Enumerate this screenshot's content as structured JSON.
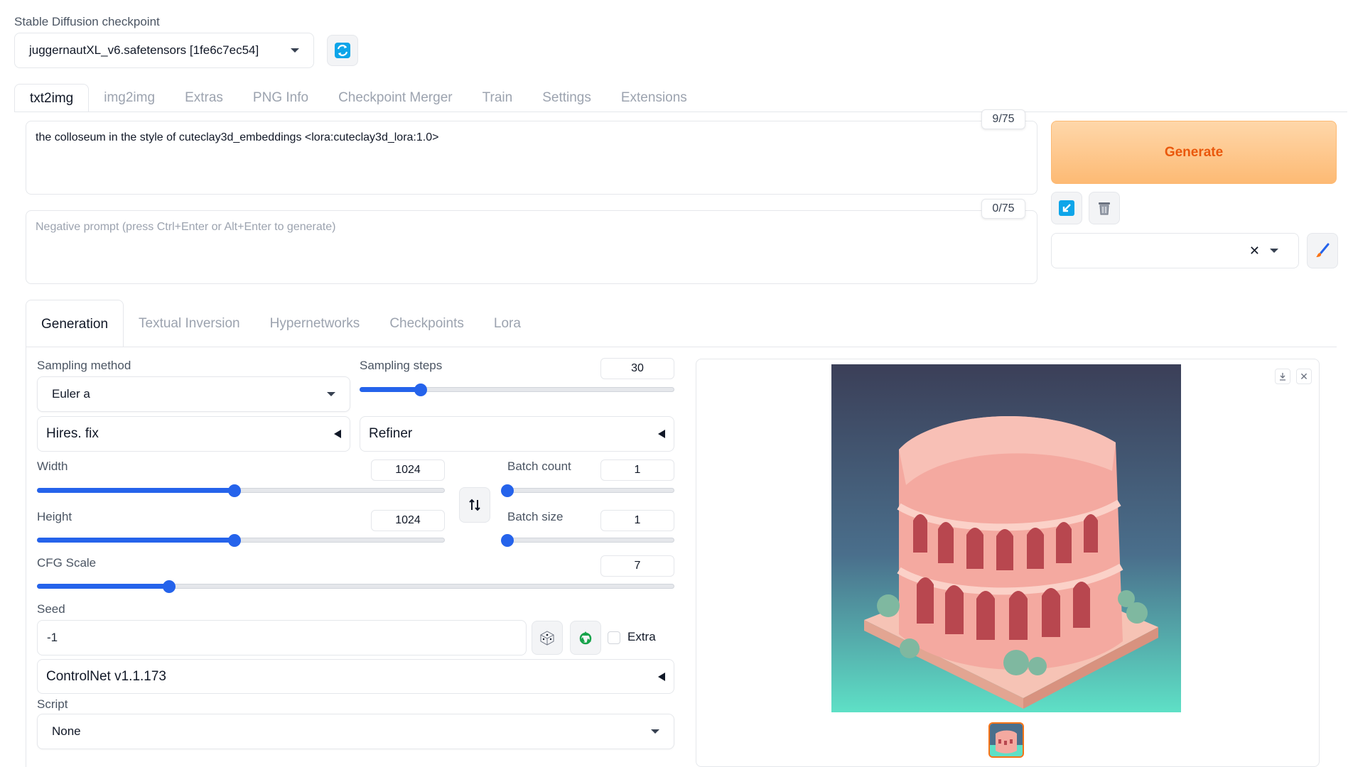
{
  "checkpoint": {
    "label": "Stable Diffusion checkpoint",
    "value": "juggernautXL_v6.safetensors [1fe6c7ec54]"
  },
  "top_tabs": [
    "txt2img",
    "img2img",
    "Extras",
    "PNG Info",
    "Checkpoint Merger",
    "Train",
    "Settings",
    "Extensions"
  ],
  "prompt": {
    "value": "the colloseum in the style of cuteclay3d_embeddings <lora:cuteclay3d_lora:1.0>",
    "counter": "9/75"
  },
  "negative_prompt": {
    "placeholder": "Negative prompt (press Ctrl+Enter or Alt+Enter to generate)",
    "counter": "0/75"
  },
  "generate_label": "Generate",
  "sub_tabs": [
    "Generation",
    "Textual Inversion",
    "Hypernetworks",
    "Checkpoints",
    "Lora"
  ],
  "sampling_method": {
    "label": "Sampling method",
    "value": "Euler a"
  },
  "sampling_steps": {
    "label": "Sampling steps",
    "value": "30",
    "min": 1,
    "max": 150
  },
  "hires_fix": "Hires. fix",
  "refiner": "Refiner",
  "width": {
    "label": "Width",
    "value": "1024",
    "min": 64,
    "max": 2048
  },
  "height": {
    "label": "Height",
    "value": "1024",
    "min": 64,
    "max": 2048
  },
  "batch_count": {
    "label": "Batch count",
    "value": "1",
    "min": 1,
    "max": 100
  },
  "batch_size": {
    "label": "Batch size",
    "value": "1",
    "min": 1,
    "max": 8
  },
  "cfg_scale": {
    "label": "CFG Scale",
    "value": "7",
    "min": 1,
    "max": 30
  },
  "seed": {
    "label": "Seed",
    "value": "-1",
    "extra_label": "Extra"
  },
  "controlnet": "ControlNet v1.1.173",
  "script": {
    "label": "Script",
    "value": "None"
  },
  "colors": {
    "accent": "#2563eb",
    "generate_bg": "#fdba74",
    "generate_text": "#ea580c"
  }
}
